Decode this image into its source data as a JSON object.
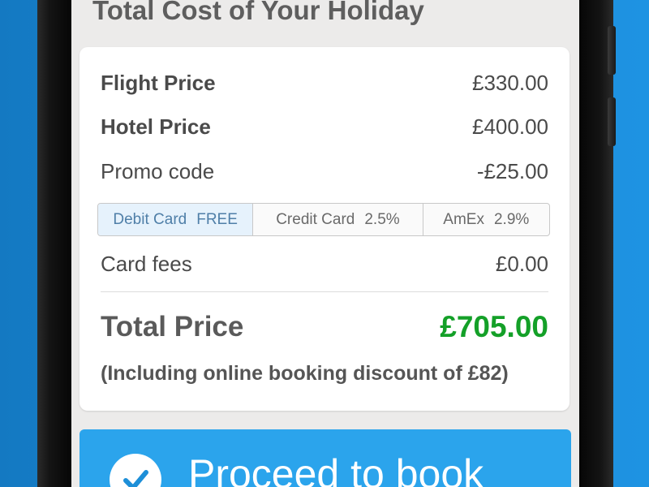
{
  "page": {
    "title": "Total Cost of Your Holiday"
  },
  "costs": {
    "flight": {
      "label": "Flight Price",
      "value": "£330.00"
    },
    "hotel": {
      "label": "Hotel Price",
      "value": "£400.00"
    },
    "promo": {
      "label": "Promo code",
      "value": "-£25.00"
    },
    "card_fees": {
      "label": "Card fees",
      "value": "£0.00"
    }
  },
  "payment_options": [
    {
      "name": "Debit Card",
      "fee": "FREE",
      "selected": true
    },
    {
      "name": "Credit Card",
      "fee": "2.5%",
      "selected": false
    },
    {
      "name": "AmEx",
      "fee": "2.9%",
      "selected": false
    }
  ],
  "total": {
    "label": "Total Price",
    "value": "£705.00",
    "note": "(Including online booking discount of £82)"
  },
  "proceed": {
    "label": "Proceed to book",
    "icon": "checkmark-icon"
  },
  "colors": {
    "background": "#1a8ad8",
    "total_green": "#14a028",
    "button_blue": "#2ba4ec",
    "selected_option": "#e6f2fc"
  }
}
